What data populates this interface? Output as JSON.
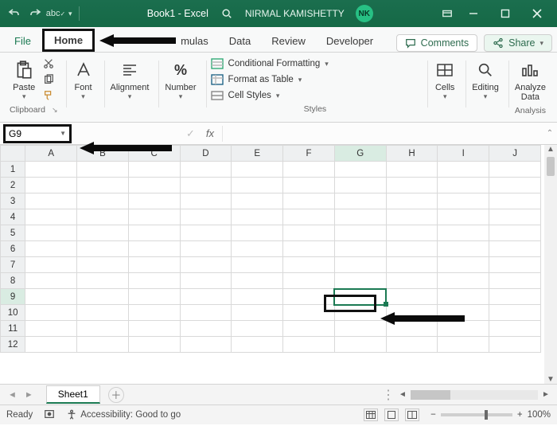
{
  "titlebar": {
    "doc_title": "Book1 - Excel",
    "user_name": "NIRMAL KAMISHETTY",
    "user_initials": "NK"
  },
  "tabs": {
    "file": "File",
    "home": "Home",
    "formulas": "mulas",
    "data": "Data",
    "review": "Review",
    "developer": "Developer"
  },
  "actions": {
    "comments": "Comments",
    "share": "Share"
  },
  "ribbon": {
    "clipboard": {
      "paste": "Paste",
      "label": "Clipboard"
    },
    "font": {
      "label": "Font"
    },
    "alignment": {
      "label": "Alignment"
    },
    "number": {
      "label": "Number"
    },
    "styles": {
      "conditional": "Conditional Formatting",
      "table": "Format as Table",
      "cell": "Cell Styles",
      "label": "Styles"
    },
    "cells": {
      "label": "Cells"
    },
    "editing": {
      "label": "Editing"
    },
    "analysis": {
      "analyze": "Analyze",
      "data": "Data",
      "label": "Analysis"
    }
  },
  "namebox": "G9",
  "columns": [
    "A",
    "B",
    "C",
    "D",
    "E",
    "F",
    "G",
    "H",
    "I",
    "J"
  ],
  "rows": [
    "1",
    "2",
    "3",
    "4",
    "5",
    "6",
    "7",
    "8",
    "9",
    "10",
    "11",
    "12"
  ],
  "active_cell": {
    "col": "G",
    "row": "9"
  },
  "sheets": {
    "sheet1": "Sheet1"
  },
  "status": {
    "ready": "Ready",
    "accessibility": "Accessibility: Good to go",
    "zoom": "100%"
  }
}
